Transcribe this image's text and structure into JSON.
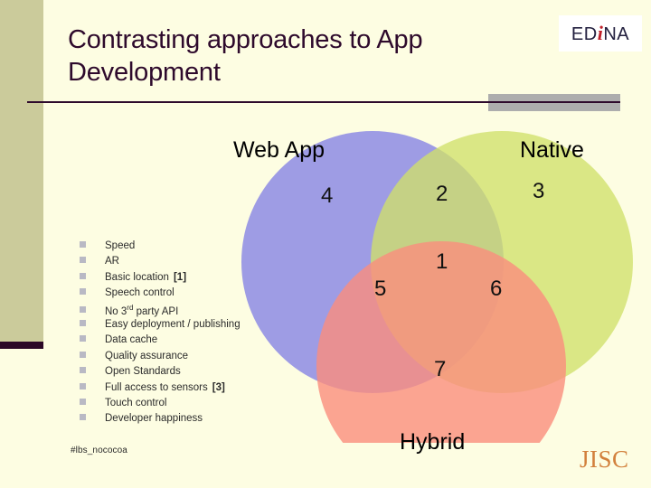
{
  "slide": {
    "title": "Contrasting approaches to App Development",
    "footer_tag": "#lbs_nococoa"
  },
  "logos": {
    "edina": {
      "prefix": "ED",
      "accent": "i",
      "suffix": "NA",
      "accent_color": "#c0202a"
    },
    "jisc": {
      "text": "JISC",
      "color": "#d2803c"
    }
  },
  "venn": {
    "labels": {
      "web_app": "Web App",
      "native": "Native",
      "hybrid": "Hybrid"
    },
    "regions": [
      {
        "id": "webapp-only",
        "number": "4"
      },
      {
        "id": "webapp-native",
        "number": "2"
      },
      {
        "id": "native-only",
        "number": "3"
      },
      {
        "id": "all-three",
        "number": "1"
      },
      {
        "id": "webapp-hybrid",
        "number": "5"
      },
      {
        "id": "native-hybrid",
        "number": "6"
      },
      {
        "id": "hybrid-only",
        "number": "7"
      }
    ],
    "colors": {
      "web_app": "#8d8be4",
      "native": "#d3e48c",
      "hybrid": "#f9998b"
    }
  },
  "features": [
    {
      "label": "Speed",
      "ref": ""
    },
    {
      "label": "AR",
      "ref": ""
    },
    {
      "label": "Basic location",
      "ref": "[1]"
    },
    {
      "label": "Speech control",
      "ref": ""
    },
    {
      "label": "No 3rd party API",
      "ref": "",
      "sup": "rd",
      "pre": "No 3",
      "post": " party API"
    },
    {
      "label": "Easy deployment / publishing",
      "ref": ""
    },
    {
      "label": "Data cache",
      "ref": ""
    },
    {
      "label": "Quality assurance",
      "ref": ""
    },
    {
      "label": "Open Standards",
      "ref": ""
    },
    {
      "label": "Full access to sensors",
      "ref": "[3]"
    },
    {
      "label": "Touch control",
      "ref": ""
    },
    {
      "label": "Developer happiness",
      "ref": ""
    }
  ]
}
